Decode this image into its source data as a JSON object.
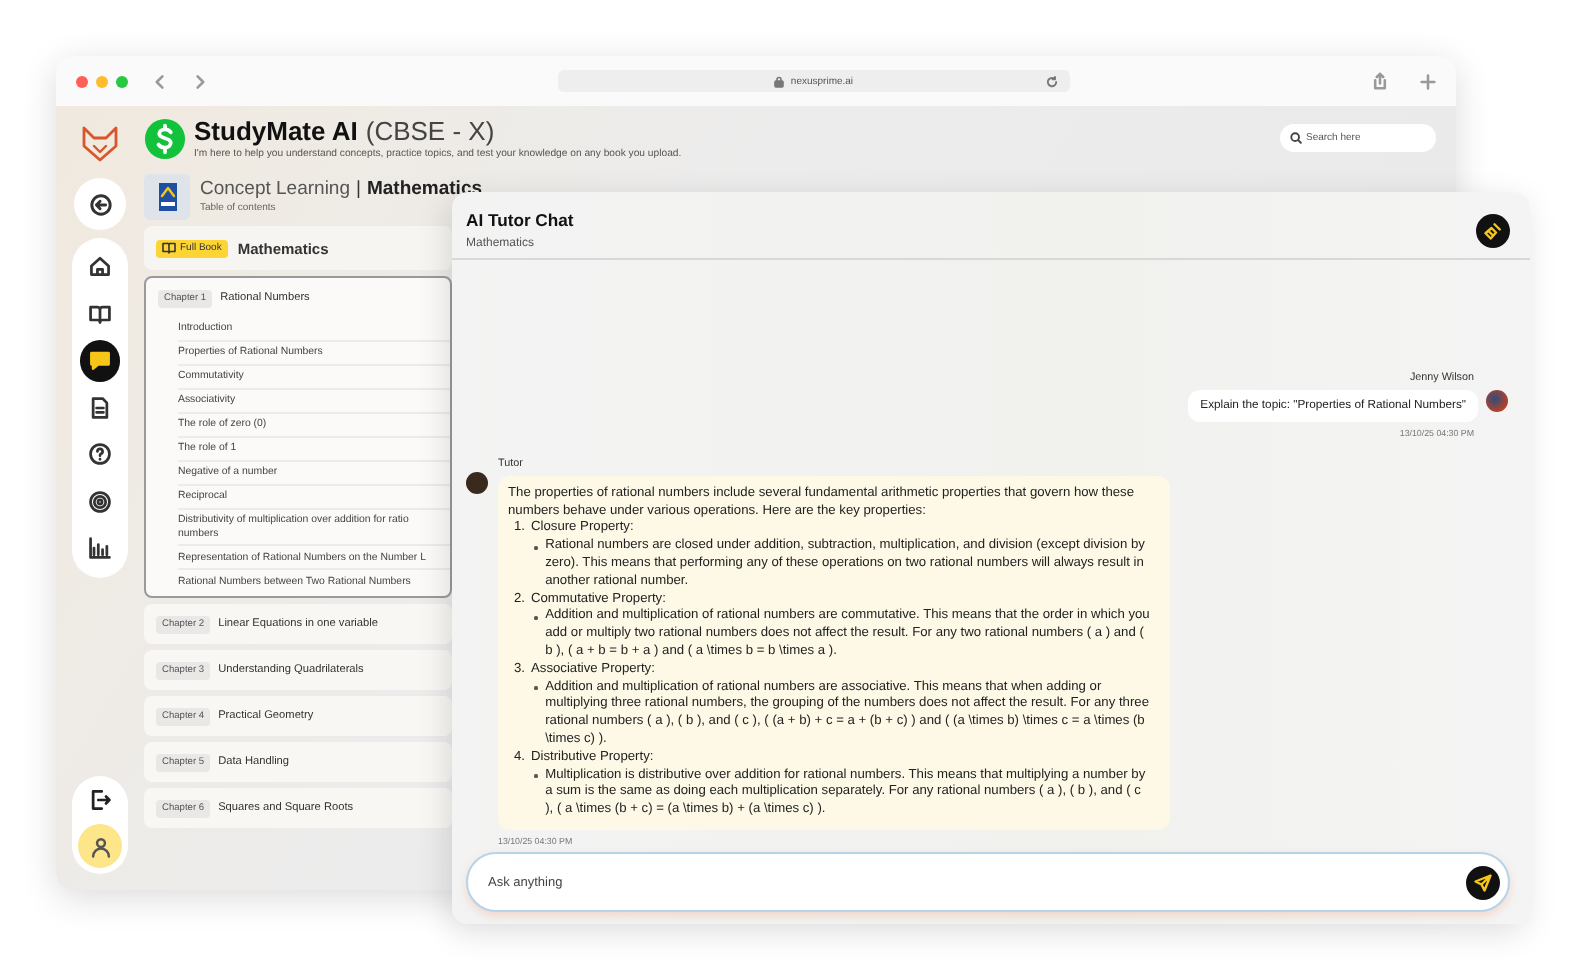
{
  "browser": {
    "url": "nexusprime.ai"
  },
  "app": {
    "title": "StudyMate AI",
    "title_suffix": "(CBSE - X)",
    "subtitle": "I'm here to help you understand concepts, practice topics, and test your knowledge on any book you upload.",
    "search": {
      "placeholder": "Search here"
    }
  },
  "sidebar": {
    "items": [
      {
        "selected": false
      },
      {
        "selected": false
      },
      {
        "selected": true
      },
      {
        "selected": false
      },
      {
        "selected": false
      },
      {
        "selected": false
      },
      {
        "selected": false
      }
    ]
  },
  "book": {
    "section": "Concept Learning",
    "separator": "|",
    "subject": "Mathematics",
    "caption": "Table of contents"
  },
  "contents": {
    "badge": "Full Book",
    "title": "Mathematics",
    "chapters": [
      {
        "label": "Chapter 1",
        "title": "Rational Numbers",
        "expanded": true,
        "topics": [
          "Introduction",
          "Properties of Rational Numbers",
          "Commutativity",
          "Associativity",
          "The role of zero (0)",
          "The role of 1",
          "Negative of a number",
          "Reciprocal",
          "Distributivity of multiplication over addition for ratio\nnumbers",
          "Representation of Rational Numbers on the Number L",
          "Rational Numbers between Two Rational Numbers"
        ]
      },
      {
        "label": "Chapter 2",
        "title": "Linear Equations in one variable",
        "expanded": false
      },
      {
        "label": "Chapter 3",
        "title": "Understanding Quadrilaterals",
        "expanded": false
      },
      {
        "label": "Chapter 4",
        "title": "Practical Geometry",
        "expanded": false
      },
      {
        "label": "Chapter 5",
        "title": "Data Handling",
        "expanded": false
      },
      {
        "label": "Chapter 6",
        "title": "Squares and Square Roots",
        "expanded": false
      }
    ]
  },
  "chat": {
    "title": "AI Tutor Chat",
    "subtitle": "Mathematics",
    "messages": [
      {
        "kind": "user",
        "sender": "Jenny Wilson",
        "text": "Explain the topic: \"Properties of Rational Numbers\"",
        "time": "13/10/25 04:30 PM"
      },
      {
        "kind": "tutor",
        "sender": "Tutor",
        "intro": "The properties of rational numbers include several fundamental arithmetic properties that govern how these numbers behave under various operations. Here are the key properties:",
        "points": [
          {
            "number": "1.",
            "title": "Closure Property:",
            "details": [
              "Rational numbers are closed under addition, subtraction, multiplication, and division (except division by zero). This means that performing any of these operations on two rational numbers will always result in another rational number."
            ]
          },
          {
            "number": "2.",
            "title": "Commutative Property:",
            "details": [
              "Addition and multiplication of rational numbers are commutative. This means that the order in which you add or multiply two rational numbers does not affect the result. For any two rational numbers ( a ) and ( b ), ( a + b = b + a ) and ( a \\times b = b \\times a )."
            ]
          },
          {
            "number": "3.",
            "title": "Associative Property:",
            "details": [
              "Addition and multiplication of rational numbers are associative. This means that when adding or multiplying three rational numbers, the grouping of the numbers does not affect the result. For any three rational numbers ( a ), ( b ), and ( c ), ( (a + b) + c = a + (b + c) ) and ( (a \\times b) \\times c = a \\times (b \\times c) )."
            ]
          },
          {
            "number": "4.",
            "title": "Distributive Property:",
            "details": [
              "Multiplication is distributive over addition for rational numbers. This means that multiplying a number by a sum is the same as doing each multiplication separately. For any rational numbers ( a ), ( b ), and ( c ), ( a \\times (b + c) = (a \\times b) + (a \\times c) )."
            ]
          }
        ],
        "time": "13/10/25 04:30 PM"
      }
    ],
    "input": {
      "placeholder": "Ask anything"
    }
  }
}
